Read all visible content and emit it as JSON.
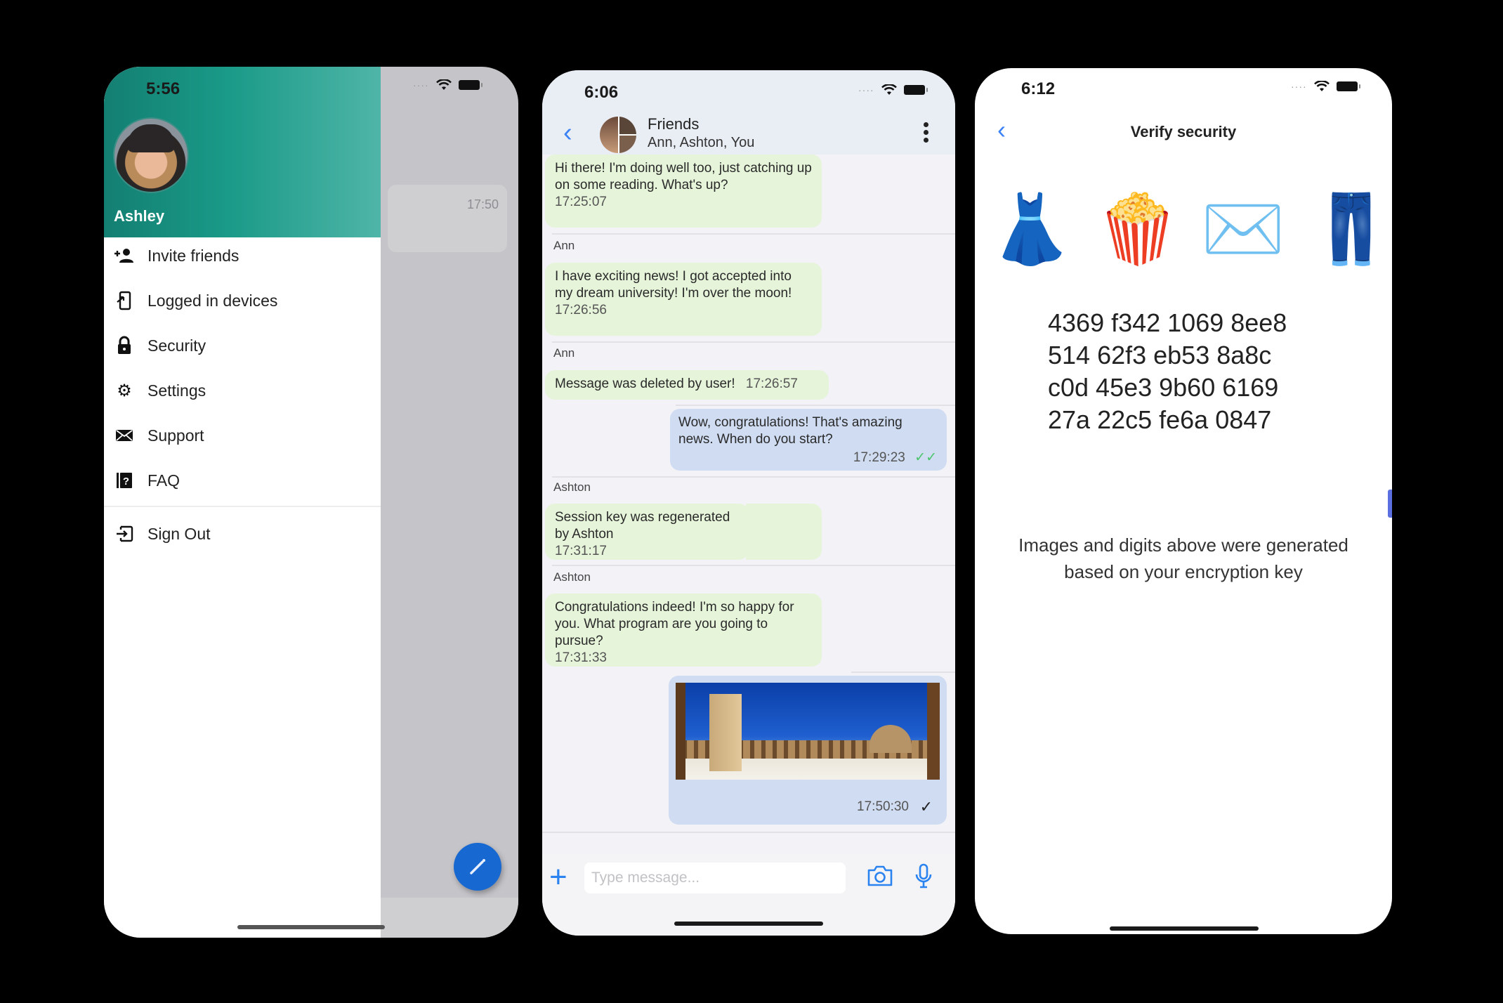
{
  "screens": {
    "drawer": {
      "status_time": "5:56",
      "user_name": "Ashley",
      "menu": [
        {
          "label": "Invite friends",
          "icon": "person-add-icon"
        },
        {
          "label": "Logged in devices",
          "icon": "device-login-icon"
        },
        {
          "label": "Security",
          "icon": "lock-icon"
        },
        {
          "label": "Settings",
          "icon": "gear-icon"
        },
        {
          "label": "Support",
          "icon": "mail-icon"
        },
        {
          "label": "FAQ",
          "icon": "help-book-icon"
        },
        {
          "label": "Sign Out",
          "icon": "sign-out-icon"
        }
      ],
      "background_chat_time": "17:50",
      "compose_icon": "pencil-icon",
      "accent_color": "#1a9a88"
    },
    "chat": {
      "status_time": "6:06",
      "title": "Friends",
      "subtitle": "Ann, Ashton, You",
      "messages": [
        {
          "direction": "in",
          "sender": "",
          "text": "Hi there! I'm doing well too, just catching up on some reading. What's up?",
          "time": "17:25:07"
        },
        {
          "direction": "in",
          "sender": "Ann",
          "text": "I have exciting news! I got accepted into my dream university! I'm over the moon!",
          "time": "17:26:56"
        },
        {
          "direction": "in",
          "sender": "Ann",
          "text": "Message was deleted by user!",
          "time": "17:26:57"
        },
        {
          "direction": "out",
          "sender": "",
          "text": "Wow, congratulations! That's amazing news. When do you start?",
          "time": "17:29:23",
          "status": "read"
        },
        {
          "direction": "in",
          "sender": "Ashton",
          "text": "Session key was regenerated by Ashton",
          "time": "17:31:17"
        },
        {
          "direction": "in",
          "sender": "Ashton",
          "text": "Congratulations indeed! I'm so happy for you. What program are you going to pursue?",
          "time": "17:31:33"
        },
        {
          "direction": "out",
          "sender": "",
          "type": "image",
          "image_desc": "mosque courtyard under blue sky",
          "time": "17:50:30",
          "status": "sent"
        }
      ],
      "composer": {
        "placeholder": "Type message..."
      },
      "accent_color": "#2b83f0",
      "incoming_bubble_color": "#e6f4da",
      "outgoing_bubble_color": "#cfdcf2"
    },
    "verify": {
      "status_time": "6:12",
      "title": "Verify security",
      "emojis": [
        {
          "glyph": "👗",
          "name": "dress"
        },
        {
          "glyph": "🍿",
          "name": "popcorn"
        },
        {
          "glyph": "✉️",
          "name": "envelope"
        },
        {
          "glyph": "👖",
          "name": "jeans"
        }
      ],
      "digits": [
        "4369 f342 1069 8ee8",
        "514 62f3 eb53 8a8c",
        "c0d 45e3 9b60 6169",
        "27a 22c5 fe6a 0847"
      ],
      "note": "Images and digits above were generated based on your encryption key"
    }
  }
}
